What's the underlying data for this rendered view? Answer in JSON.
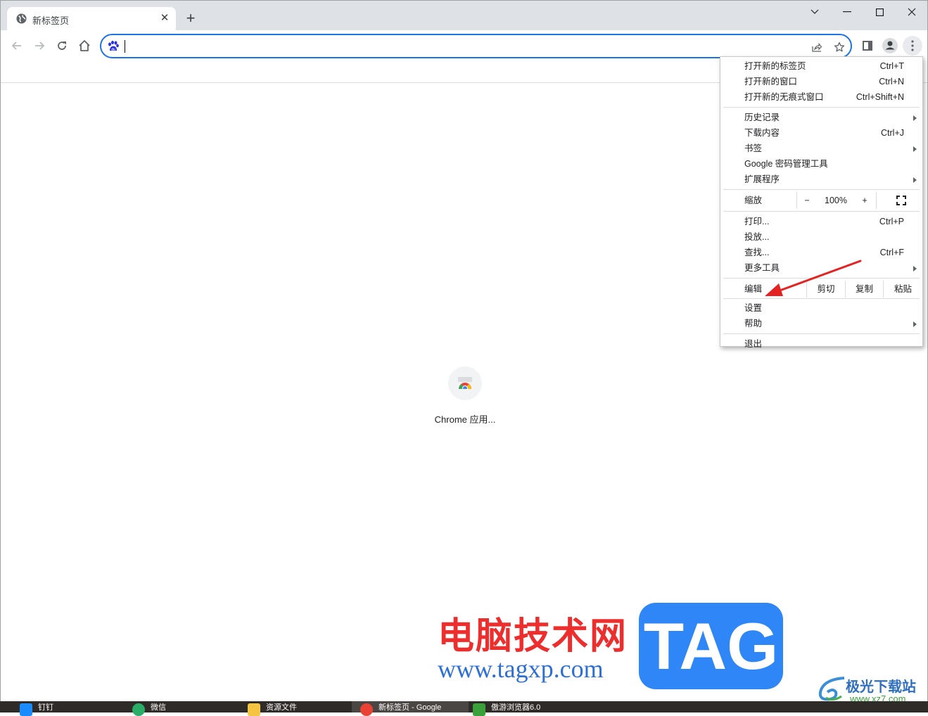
{
  "tab": {
    "title": "新标签页",
    "close_label": "✕"
  },
  "newtab_label": "+",
  "window_controls": {
    "tabsearch": "⌄",
    "minimize": "—",
    "maximize": "☐",
    "close": "✕"
  },
  "omnibox": {
    "value": "",
    "placeholder": ""
  },
  "shortcut": {
    "label": "Chrome 应用..."
  },
  "menu": {
    "group1": [
      {
        "label": "打开新的标签页",
        "shortcut": "Ctrl+T"
      },
      {
        "label": "打开新的窗口",
        "shortcut": "Ctrl+N"
      },
      {
        "label": "打开新的无痕式窗口",
        "shortcut": "Ctrl+Shift+N"
      }
    ],
    "group2": [
      {
        "label": "历史记录",
        "shortcut": "",
        "submenu": true
      },
      {
        "label": "下载内容",
        "shortcut": "Ctrl+J",
        "submenu": false
      },
      {
        "label": "书签",
        "shortcut": "",
        "submenu": true
      },
      {
        "label": "Google 密码管理工具",
        "shortcut": "",
        "submenu": false
      },
      {
        "label": "扩展程序",
        "shortcut": "",
        "submenu": true
      }
    ],
    "zoom": {
      "label": "缩放",
      "minus": "−",
      "value": "100%",
      "plus": "+"
    },
    "group3": [
      {
        "label": "打印...",
        "shortcut": "Ctrl+P",
        "submenu": false
      },
      {
        "label": "投放...",
        "shortcut": "",
        "submenu": false
      },
      {
        "label": "查找...",
        "shortcut": "Ctrl+F",
        "submenu": false
      },
      {
        "label": "更多工具",
        "shortcut": "",
        "submenu": true
      }
    ],
    "edit": {
      "label": "编辑",
      "cut": "剪切",
      "copy": "复制",
      "paste": "粘贴"
    },
    "group4": [
      {
        "label": "设置",
        "submenu": false
      },
      {
        "label": "帮助",
        "submenu": true
      }
    ],
    "exit": "退出"
  },
  "taskbar": [
    {
      "label": "钉钉",
      "color": "#1a8cff"
    },
    {
      "label": "微信",
      "color": "#2aae67"
    },
    {
      "label": "资源文件",
      "color": "#f5c542"
    },
    {
      "label": "新标签页 - Google",
      "color": "#e94235",
      "active": true
    },
    {
      "label": "傲游浏览器6.0",
      "color": "#3aa03a"
    }
  ],
  "watermark": {
    "site_cn": "电脑技术网",
    "site_url": "www.tagxp.com",
    "tag": "TAG",
    "xz_cn": "极光下载站",
    "xz_url": "www.xz7.com"
  },
  "colors": {
    "accent": "#1a73e8",
    "annotation_arrow": "#e52222"
  }
}
